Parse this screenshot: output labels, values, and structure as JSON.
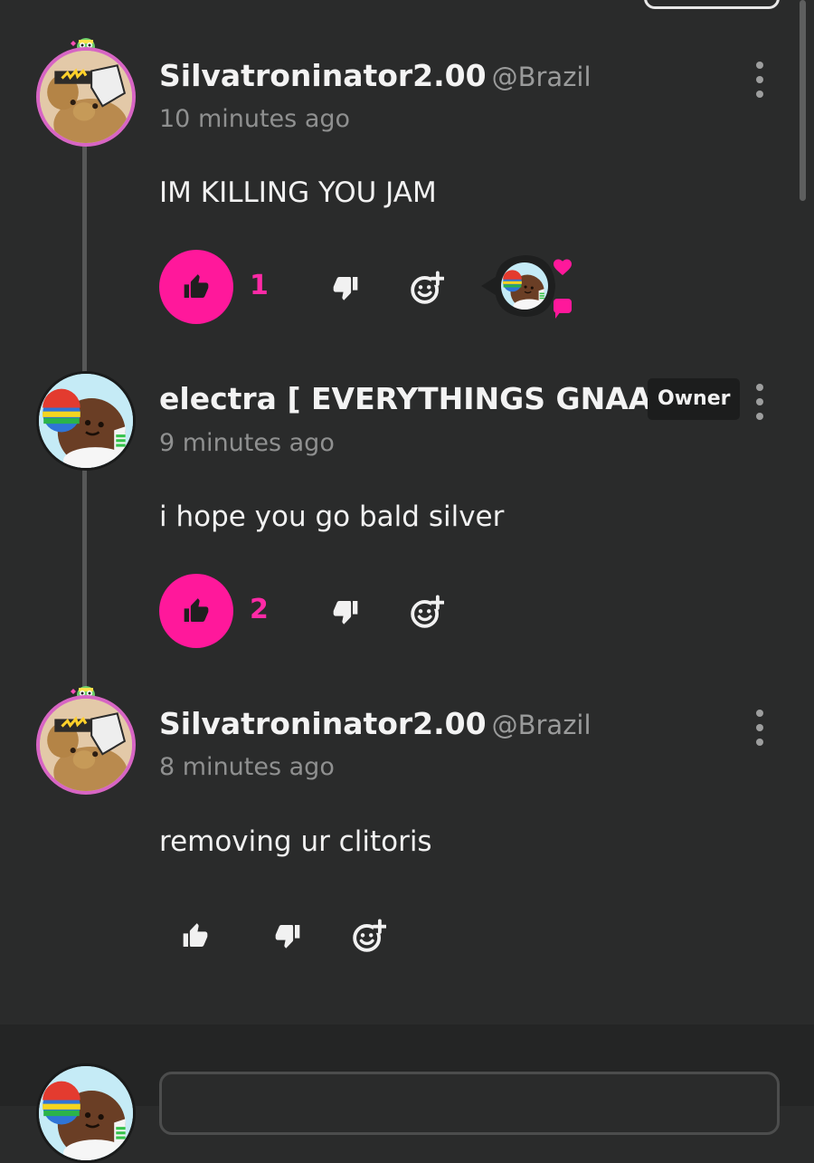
{
  "comments": [
    {
      "username": "Silvatroninator2.00",
      "handle": "@Brazil",
      "time": "10 minutes ago",
      "text": "IM KILLING YOU JAM",
      "likes": "1",
      "liked": true
    },
    {
      "username": "electra [ EVERYTHINGS GNAA...",
      "badge": "Owner",
      "time": "9 minutes ago",
      "text": "i hope you go bald silver",
      "likes": "2",
      "liked": true
    },
    {
      "username": "Silvatroninator2.00",
      "handle": "@Brazil",
      "time": "8 minutes ago",
      "text": "removing ur clitoris",
      "likes": "",
      "liked": false
    }
  ],
  "icons": {
    "like": "thumbs-up-icon",
    "dislike": "thumbs-down-icon",
    "react": "add-reaction-icon",
    "more": "more-vertical-icon",
    "heart": "heart-icon"
  },
  "colors": {
    "background": "#2a2b2b",
    "accent": "#ff189b",
    "muted_text": "#8f9090",
    "badge_bg": "#1c1d1d"
  }
}
